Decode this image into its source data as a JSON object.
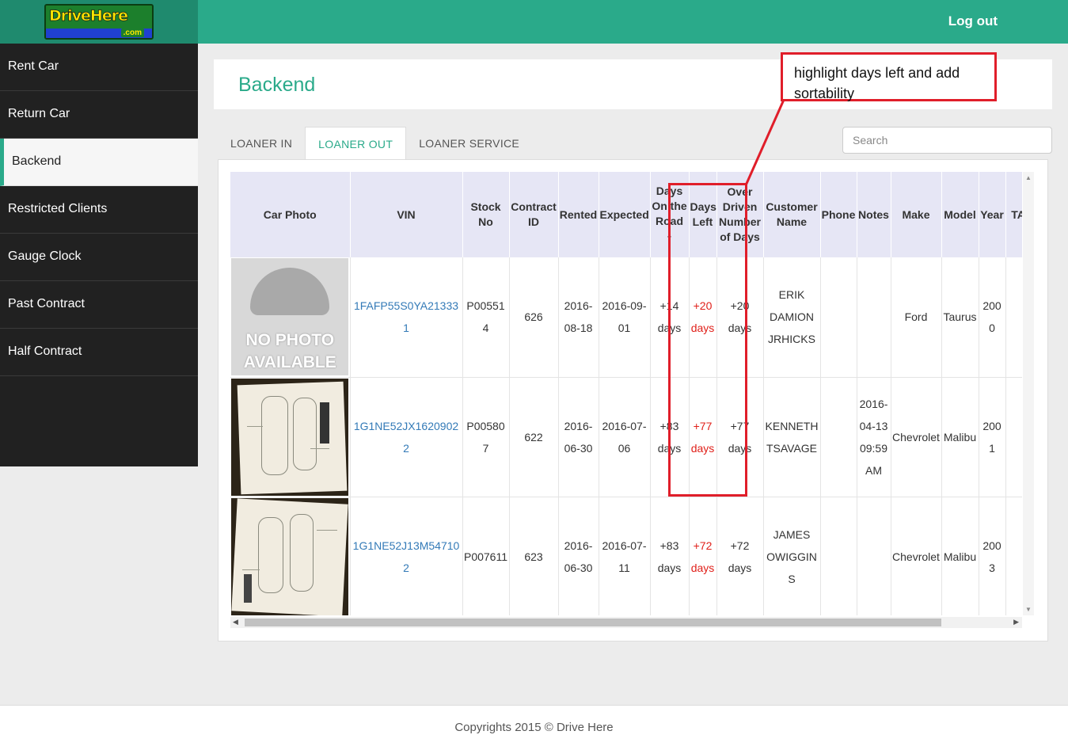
{
  "logo": {
    "text": "DriveHere",
    "suffix": ".com"
  },
  "header": {
    "logout": "Log out"
  },
  "sidebar": {
    "items": [
      {
        "label": "Rent Car"
      },
      {
        "label": "Return Car"
      },
      {
        "label": "Backend",
        "active": true
      },
      {
        "label": "Restricted Clients"
      },
      {
        "label": "Gauge Clock"
      },
      {
        "label": "Past Contract"
      },
      {
        "label": "Half Contract"
      }
    ]
  },
  "page": {
    "title": "Backend"
  },
  "tabs": [
    {
      "label": "LOANER IN"
    },
    {
      "label": "LOANER OUT",
      "active": true
    },
    {
      "label": "LOANER SERVICE"
    }
  ],
  "search": {
    "placeholder": "Search",
    "value": ""
  },
  "table": {
    "columns": [
      "Car Photo",
      "VIN",
      "Stock No",
      "Contract ID",
      "Rented",
      "Expected",
      "Days On the Road",
      "Days Left",
      "Over Driven Number of Days",
      "Customer Name",
      "Phone",
      "Notes",
      "Make",
      "Model",
      "Year",
      "TAG"
    ],
    "sorted_column": "Days On the Road",
    "rows": [
      {
        "photo": "NO PHOTO AVAILABLE",
        "vin": "1FAFP55S0YA213331",
        "stock": "P005514",
        "contract": "626",
        "rented": "2016-08-18",
        "expected": "2016-09-01",
        "days_on_road": "+14 days",
        "days_left": "+20 days",
        "over_driven": "+20 days",
        "customer": "ERIK DAMION JRHICKS",
        "phone": "",
        "notes": "",
        "make": "Ford",
        "model": "Taurus",
        "year": "2000"
      },
      {
        "photo": "inspection sheet",
        "vin": "1G1NE52JX16209022",
        "stock": "P005807",
        "contract": "622",
        "rented": "2016-06-30",
        "expected": "2016-07-06",
        "days_on_road": "+83 days",
        "days_left": "+77 days",
        "over_driven": "+77 days",
        "customer": "KENNETH TSAVAGE",
        "phone": "",
        "notes": "2016-04-13 09:59 AM",
        "make": "Chevrolet",
        "model": "Malibu",
        "year": "2001"
      },
      {
        "photo": "inspection sheet",
        "vin": "1G1NE52J13M547102",
        "stock": "P007611",
        "contract": "623",
        "rented": "2016-06-30",
        "expected": "2016-07-11",
        "days_on_road": "+83 days",
        "days_left": "+72 days",
        "over_driven": "+72 days",
        "customer": "JAMES OWIGGINS",
        "phone": "",
        "notes": "",
        "make": "Chevrolet",
        "model": "Malibu",
        "year": "2003"
      }
    ]
  },
  "annotation": {
    "text": "highlight days left and add sortability",
    "color": "#e01e2a"
  },
  "footer": {
    "text": "Copyrights 2015 © Drive Here"
  },
  "colors": {
    "accent": "#2aaa8a",
    "sidebar": "#212121",
    "link": "#337ab7",
    "days_left": "#e0201a",
    "header_row": "#e6e6f5"
  }
}
